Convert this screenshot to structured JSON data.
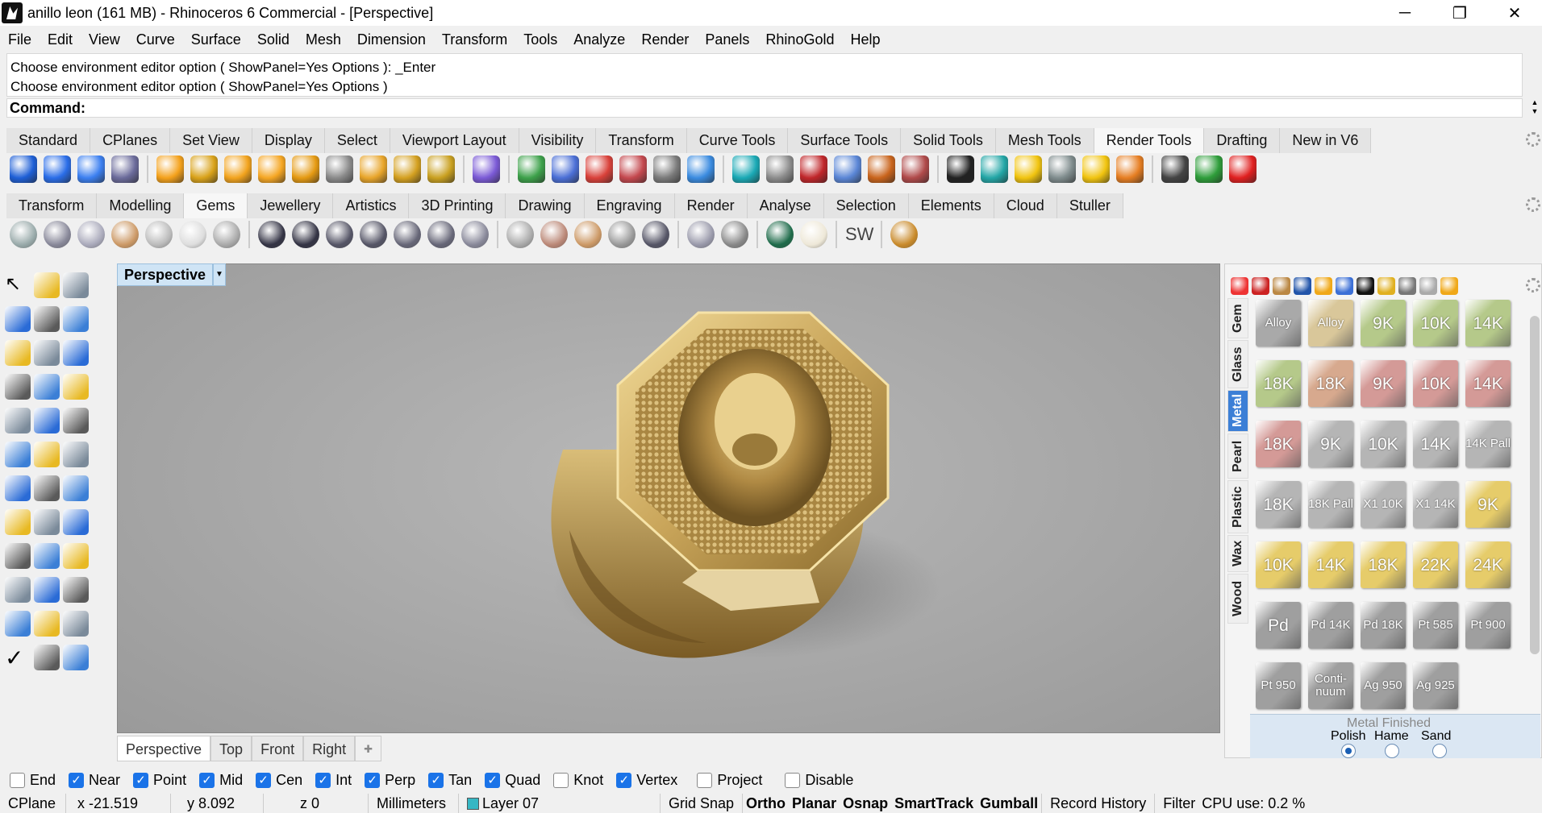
{
  "window": {
    "title": "anillo leon (161 MB) - Rhinoceros 6 Commercial - [Perspective]",
    "minimize": "─",
    "maximize": "❐",
    "close": "✕"
  },
  "menu": [
    "File",
    "Edit",
    "View",
    "Curve",
    "Surface",
    "Solid",
    "Mesh",
    "Dimension",
    "Transform",
    "Tools",
    "Analyze",
    "Render",
    "Panels",
    "RhinoGold",
    "Help"
  ],
  "command_history": [
    "Choose environment editor option ( ShowPanel=Yes  Options ): _Enter",
    "Choose environment editor option ( ShowPanel=Yes  Options )"
  ],
  "command_prompt": "Command:",
  "toolbar_tabs_1": [
    "Standard",
    "CPlanes",
    "Set View",
    "Display",
    "Select",
    "Viewport Layout",
    "Visibility",
    "Transform",
    "Curve Tools",
    "Surface Tools",
    "Solid Tools",
    "Mesh Tools",
    "Render Tools",
    "Drafting",
    "New in V6"
  ],
  "toolbar_tabs_1_active": "Render Tools",
  "toolbar_tabs_2": [
    "Transform",
    "Modelling",
    "Gems",
    "Jewellery",
    "Artistics",
    "3D Printing",
    "Drawing",
    "Engraving",
    "Render",
    "Analyse",
    "Selection",
    "Elements",
    "Cloud",
    "Stuller"
  ],
  "toolbar_tabs_2_active": "Gems",
  "icons_row_1": [
    "render-sphere-icon",
    "render-sphere-blue-icon",
    "render-sphere-light-icon",
    "render-printer-icon",
    "spotlight-icon",
    "point-light-icon",
    "directional-light-icon",
    "rectangular-light-icon",
    "linear-light-icon",
    "light-arrow-icon",
    "spot-light-2-icon",
    "light-direction-icon",
    "light-target-icon",
    "light-cone-icon",
    "material-sphere-icon",
    "texture-icon",
    "decal-icon",
    "materials-icon",
    "axes-icon",
    "cube-map-icon",
    "box-mapping-icon",
    "cylinder-mapping-icon",
    "render-box-icon",
    "sphere-map-icon",
    "texture-ball-icon",
    "wrench-pencil-icon",
    "checker-icon",
    "ground-plane-icon",
    "sun-icon",
    "grid-icon",
    "folder-icon",
    "explosion-icon",
    "film-icon",
    "play-render-icon",
    "record-icon"
  ],
  "icons_row_2": [
    "gem-cut-icon",
    "gem-line-icon",
    "gem-leaf-icon",
    "gem-star-icon",
    "gem-dimensions-icon",
    "gem-halo-icon",
    "gem-cluster-icon",
    "ring-rotate-icon",
    "ring-refresh-icon",
    "prong-icon",
    "prong-scale-icon",
    "gem-seat-icon",
    "gem-cutter-icon",
    "gem-sphere-icon",
    "pave-icon",
    "pave-array-icon",
    "pave-grid-icon",
    "pave-snow-icon",
    "diamond-round-icon",
    "diamond-radiant-icon",
    "gem-chain-icon",
    "emerald-icon",
    "pearl-icon",
    "sw-text-icon",
    "pencil-icon"
  ],
  "sw_label": "SW",
  "viewport": {
    "title": "Perspective",
    "tabs": [
      "Perspective",
      "Top",
      "Front",
      "Right"
    ],
    "active_tab": "Perspective"
  },
  "side_tools": [
    "select-arrow-icon",
    "point-icon",
    "polyline-icon",
    "curve-icon",
    "circle-icon",
    "ellipse-icon",
    "polygon-icon",
    "rectangle-icon",
    "hexagon-icon",
    "fillet-curve-icon",
    "surface-icon",
    "lofted-surface-icon",
    "box-icon",
    "sphere-icon",
    "cylinder-icon",
    "mesh-plane-icon",
    "gear-solid-icon",
    "explode-icon",
    "trim-icon",
    "split-icon",
    "boolean-icon",
    "group-icon",
    "curve-pick-icon",
    "arc-icon",
    "text-icon",
    "scale-icon",
    "array-icon",
    "layout-icon",
    "extrude-icon",
    "section-icon",
    "array-grid-icon",
    "align-icon",
    "polygon-3d-icon",
    "check-icon",
    "solid-sphere-icon",
    "shade-icon"
  ],
  "osnaps": [
    {
      "label": "End",
      "on": false
    },
    {
      "label": "Near",
      "on": true
    },
    {
      "label": "Point",
      "on": true
    },
    {
      "label": "Mid",
      "on": true
    },
    {
      "label": "Cen",
      "on": true
    },
    {
      "label": "Int",
      "on": true
    },
    {
      "label": "Perp",
      "on": true
    },
    {
      "label": "Tan",
      "on": true
    },
    {
      "label": "Quad",
      "on": true
    },
    {
      "label": "Knot",
      "on": false
    },
    {
      "label": "Vertex",
      "on": true
    },
    {
      "label": "Project",
      "on": false
    },
    {
      "label": "Disable",
      "on": false
    }
  ],
  "status": {
    "cplane": "CPlane",
    "x": "x -21.519",
    "y": "y 8.092",
    "z": "z 0",
    "units": "Millimeters",
    "layer": "Layer 07",
    "grid_snap": "Grid Snap",
    "ortho": "Ortho",
    "planar": "Planar",
    "osnap": "Osnap",
    "smarttrack": "SmartTrack",
    "gumball": "Gumball",
    "record_history": "Record History",
    "filter": "Filter",
    "cpu": "CPU use: 0.2 %"
  },
  "material_tabs": [
    "Gem",
    "Glass",
    "Metal",
    "Pearl",
    "Plastic",
    "Wax",
    "Wood"
  ],
  "material_tabs_active": "Metal",
  "materials": [
    [
      "Alloy",
      "Alloy",
      "9K",
      "10K",
      "14K"
    ],
    [
      "18K",
      "18K",
      "9K",
      "10K",
      "14K"
    ],
    [
      "18K",
      "9K",
      "10K",
      "14K",
      "14K Pall"
    ],
    [
      "18K",
      "18K Pall",
      "X1 10K",
      "X1 14K",
      "9K"
    ],
    [
      "10K",
      "14K",
      "18K",
      "22K",
      "24K"
    ],
    [
      "Pd",
      "Pd 14K",
      "Pd 18K",
      "Pt 585",
      "Pt 900"
    ],
    [
      "Pt 950",
      "Conti- nuum",
      "Ag 950",
      "Ag 925"
    ]
  ],
  "material_colors": [
    [
      "#a9a9a9",
      "#d9c79a",
      "#b5c98a",
      "#b5c98a",
      "#b5c98a"
    ],
    [
      "#b5c98a",
      "#d7a98e",
      "#d49a97",
      "#d49a97",
      "#d49a97"
    ],
    [
      "#d49a97",
      "#b5b5b5",
      "#b5b5b5",
      "#b5b5b5",
      "#b5b5b5"
    ],
    [
      "#b5b5b5",
      "#b5b5b5",
      "#b5b5b5",
      "#b5b5b5",
      "#e6cc6a"
    ],
    [
      "#e6cc6a",
      "#e6cc6a",
      "#e6cc6a",
      "#e6cc6a",
      "#e6cc6a"
    ],
    [
      "#9f9f9f",
      "#9f9f9f",
      "#9f9f9f",
      "#9f9f9f",
      "#9f9f9f"
    ],
    [
      "#9f9f9f",
      "#9f9f9f",
      "#9f9f9f",
      "#9f9f9f"
    ]
  ],
  "finish": {
    "title": "Metal Finished",
    "options": [
      "Polish",
      "Hame",
      "Sand"
    ],
    "selected": "Polish"
  },
  "colors": {
    "accent": "#1a73e8",
    "viewport_title_bg": "#cfe4f5",
    "gold": "#c9a55a"
  }
}
